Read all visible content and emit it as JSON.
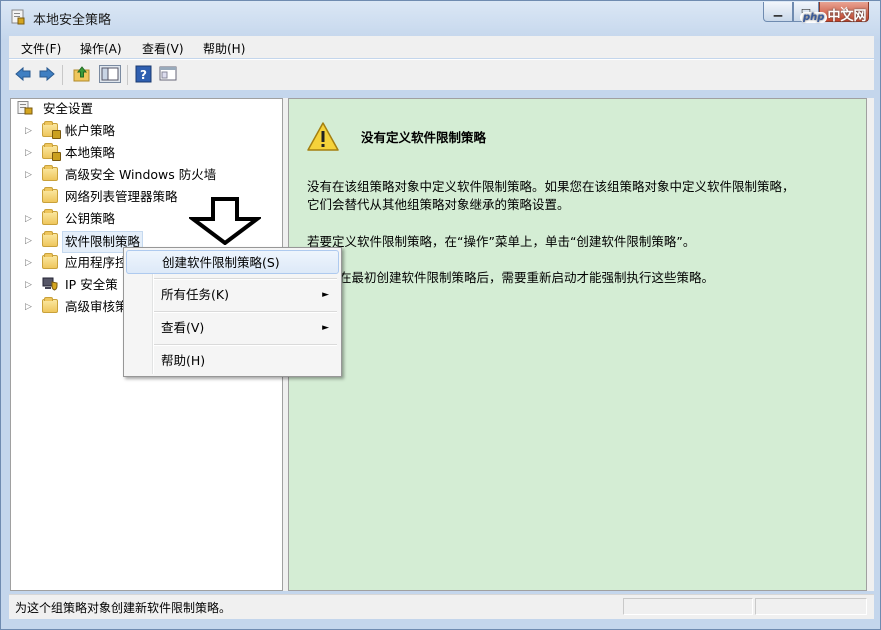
{
  "window": {
    "title": "本地安全策略"
  },
  "watermark": {
    "badge": "php",
    "text": "中文网"
  },
  "menubar": [
    {
      "label": "文件(F)"
    },
    {
      "label": "操作(A)"
    },
    {
      "label": "查看(V)"
    },
    {
      "label": "帮助(H)"
    }
  ],
  "toolbar": {
    "icons": [
      "back-arrow-icon",
      "forward-arrow-icon",
      "up-folder-icon",
      "show-hide-tree-icon",
      "help-icon",
      "properties-icon"
    ]
  },
  "tree": {
    "root": "安全设置",
    "items": [
      {
        "label": "帐户策略",
        "expandable": true,
        "icon": "folder-lock-icon"
      },
      {
        "label": "本地策略",
        "expandable": true,
        "icon": "folder-lock-icon"
      },
      {
        "label": "高级安全 Windows 防火墙",
        "expandable": true,
        "icon": "folder-icon"
      },
      {
        "label": "网络列表管理器策略",
        "expandable": false,
        "icon": "folder-icon"
      },
      {
        "label": "公钥策略",
        "expandable": true,
        "icon": "folder-icon"
      },
      {
        "label": "软件限制策略",
        "expandable": true,
        "icon": "folder-icon"
      },
      {
        "label": "应用程序控",
        "expandable": true,
        "icon": "folder-icon"
      },
      {
        "label": "IP 安全策",
        "expandable": true,
        "icon": "computer-shield-icon"
      },
      {
        "label": "高级审核策",
        "expandable": true,
        "icon": "folder-icon"
      }
    ]
  },
  "context_menu": {
    "items": [
      {
        "label": "创建软件限制策略(S)",
        "submenu": false
      },
      {
        "label": "所有任务(K)",
        "submenu": true
      },
      {
        "label": "查看(V)",
        "submenu": true
      },
      {
        "label": "帮助(H)",
        "submenu": false
      }
    ],
    "submenu_glyph": "►"
  },
  "right_pane": {
    "title": "没有定义软件限制策略",
    "paragraph1_line1": "没有在该组策略对象中定义软件限制策略。如果您在该组策略对象中定义软件限制策略，",
    "paragraph1_line2": "它们会替代从其他组策略对象继承的策略设置。",
    "paragraph2": "若要定义软件限制策略，在“操作”菜单上，单击“创建软件限制策略”。",
    "paragraph3": "在最初创建软件限制策略后，需要重新启动才能强制执行这些策略。"
  },
  "statusbar": {
    "text": "为这个组策略对象创建新软件限制策略。"
  },
  "colors": {
    "right_pane_bg": "#d4edd4",
    "hover": "#dde9f8"
  }
}
